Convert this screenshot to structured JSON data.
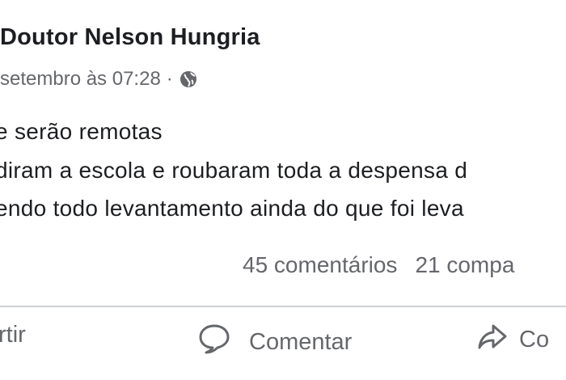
{
  "post": {
    "author": "Doutor Nelson Hungria",
    "timestamp": "setembro às 07:28",
    "separator": "·",
    "privacy_icon": "globe-icon",
    "lines": [
      "e serão remotas",
      "diram a escola e roubaram toda a despensa d",
      "endo todo levantamento ainda do que foi leva"
    ]
  },
  "stats": {
    "comments": "45 comentários",
    "shares": "21 compa"
  },
  "actions": {
    "share_left": "rtir",
    "comment": "Comentar",
    "share_right": "Co"
  },
  "colors": {
    "text": "#1c1e21",
    "secondary": "#65676b",
    "divider": "#ced0d4"
  }
}
